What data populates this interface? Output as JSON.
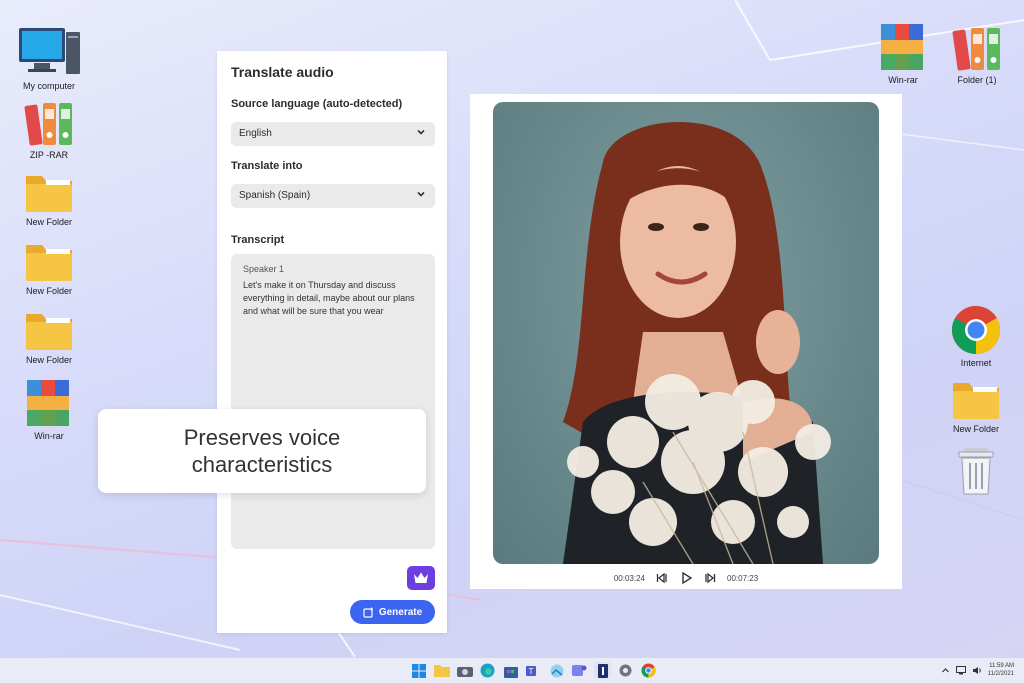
{
  "desktop": {
    "left_icons": [
      {
        "label": "My computer",
        "icon": "computer-icon"
      },
      {
        "label": "ZIP -RAR",
        "icon": "binders-icon"
      },
      {
        "label": "New Folder",
        "icon": "folder-icon"
      },
      {
        "label": "New Folder",
        "icon": "folder-icon"
      },
      {
        "label": "New Folder",
        "icon": "folder-icon"
      },
      {
        "label": "Win-rar",
        "icon": "winrar-icon"
      }
    ],
    "right_icons": [
      {
        "label": "Win-rar",
        "icon": "winrar-icon"
      },
      {
        "label": "Folder (1)",
        "icon": "binders-icon"
      },
      {
        "label": "Internet",
        "icon": "chrome-icon"
      },
      {
        "label": "New Folder",
        "icon": "folder-icon"
      },
      {
        "label": "",
        "icon": "recycle-bin-icon"
      }
    ]
  },
  "panel": {
    "title": "Translate audio",
    "source_label": "Source language (auto-detected)",
    "source_value": "English",
    "target_label": "Translate into",
    "target_value": "Spanish (Spain)",
    "transcript_label": "Transcript",
    "speaker": "Speaker 1",
    "transcript_text": "Let's make it on Thursday and discuss everything in detail, maybe about our plans and what will be sure that you wear",
    "generate_label": "Generate"
  },
  "tooltip": {
    "line1": "Preserves voice",
    "line2": "characteristics"
  },
  "player": {
    "current_time": "00:03:24",
    "total_time": "00:07:23"
  },
  "taskbar": {
    "time": "11:59 AM",
    "date": "11/2/2021"
  },
  "colors": {
    "accent": "#3b64f0",
    "premium": "#6c3de0",
    "folder": "#f6c543"
  }
}
